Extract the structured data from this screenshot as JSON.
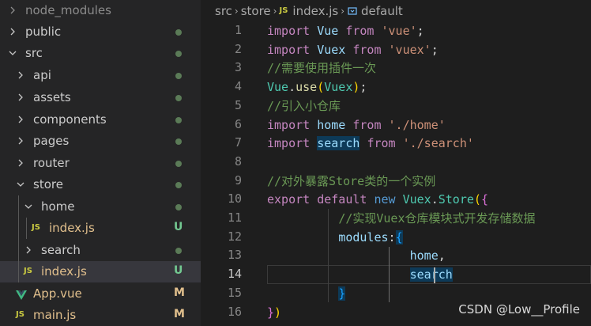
{
  "sidebar": {
    "items": [
      {
        "label": "node_modules"
      },
      {
        "label": "public"
      },
      {
        "label": "src"
      },
      {
        "label": "api"
      },
      {
        "label": "assets"
      },
      {
        "label": "components"
      },
      {
        "label": "pages"
      },
      {
        "label": "router"
      },
      {
        "label": "store"
      },
      {
        "label": "home"
      },
      {
        "label": "index.js",
        "badge": "U",
        "icon": "JS"
      },
      {
        "label": "search"
      },
      {
        "label": "index.js",
        "badge": "U",
        "icon": "JS"
      },
      {
        "label": "App.vue",
        "badge": "M"
      },
      {
        "label": "main.js",
        "badge": "M",
        "icon": "JS"
      }
    ]
  },
  "breadcrumb": {
    "parts": [
      "src",
      "store",
      "index.js",
      "default"
    ],
    "file_icon": "JS"
  },
  "editor": {
    "line_numbers": [
      "1",
      "2",
      "3",
      "4",
      "5",
      "6",
      "7",
      "8",
      "9",
      "10",
      "11",
      "12",
      "13",
      "14",
      "15",
      "16"
    ],
    "active_line": "14",
    "lines": [
      [
        {
          "t": "import",
          "c": "kw"
        },
        {
          "t": " "
        },
        {
          "t": "Vue",
          "c": "var"
        },
        {
          "t": " "
        },
        {
          "t": "from",
          "c": "kw"
        },
        {
          "t": " "
        },
        {
          "t": "'vue'",
          "c": "str"
        },
        {
          "t": ";"
        }
      ],
      [
        {
          "t": "import",
          "c": "kw"
        },
        {
          "t": " "
        },
        {
          "t": "Vuex",
          "c": "var"
        },
        {
          "t": " "
        },
        {
          "t": "from",
          "c": "kw"
        },
        {
          "t": " "
        },
        {
          "t": "'vuex'",
          "c": "str"
        },
        {
          "t": ";"
        }
      ],
      [
        {
          "t": "//需要使用插件一次",
          "c": "cmt"
        }
      ],
      [
        {
          "t": "Vue",
          "c": "cls"
        },
        {
          "t": "."
        },
        {
          "t": "use",
          "c": "fn"
        },
        {
          "t": "(",
          "c": "br1"
        },
        {
          "t": "Vuex",
          "c": "cls"
        },
        {
          "t": ")",
          "c": "br1"
        },
        {
          "t": ";"
        }
      ],
      [
        {
          "t": "//引入小仓库",
          "c": "cmt"
        }
      ],
      [
        {
          "t": "import",
          "c": "kw"
        },
        {
          "t": " "
        },
        {
          "t": "home",
          "c": "var"
        },
        {
          "t": " "
        },
        {
          "t": "from",
          "c": "kw"
        },
        {
          "t": " "
        },
        {
          "t": "'./home'",
          "c": "str"
        }
      ],
      [
        {
          "t": "import",
          "c": "kw"
        },
        {
          "t": " "
        },
        {
          "t": "search",
          "c": "var hl2"
        },
        {
          "t": " "
        },
        {
          "t": "from",
          "c": "kw"
        },
        {
          "t": " "
        },
        {
          "t": "'./search'",
          "c": "str"
        }
      ],
      [],
      [
        {
          "t": "//对外暴露Store类的一个实例",
          "c": "cmt"
        }
      ],
      [
        {
          "t": "export",
          "c": "kw"
        },
        {
          "t": " "
        },
        {
          "t": "default",
          "c": "kw"
        },
        {
          "t": " "
        },
        {
          "t": "new",
          "c": "kw2"
        },
        {
          "t": " "
        },
        {
          "t": "Vuex",
          "c": "cls"
        },
        {
          "t": "."
        },
        {
          "t": "Store",
          "c": "cls"
        },
        {
          "t": "(",
          "c": "br1"
        },
        {
          "t": "{",
          "c": "br2"
        }
      ],
      [
        {
          "t": "          "
        },
        {
          "t": "//实现Vuex仓库模块式开发存储数据",
          "c": "cmt"
        }
      ],
      [
        {
          "t": "          "
        },
        {
          "t": "modules",
          "c": "var"
        },
        {
          "t": ":"
        },
        {
          "t": "{",
          "c": "br3 hl2"
        }
      ],
      [
        {
          "t": "                    "
        },
        {
          "t": "home",
          "c": "var"
        },
        {
          "t": ","
        }
      ],
      [
        {
          "t": "                    "
        },
        {
          "t": "search",
          "c": "var hl2"
        }
      ],
      [
        {
          "t": "          "
        },
        {
          "t": "}",
          "c": "br3 hl2"
        }
      ],
      [
        {
          "t": "}",
          "c": "br2"
        },
        {
          "t": ")",
          "c": "br1"
        }
      ]
    ]
  },
  "watermark": "CSDN @Low__Profile",
  "colors": {
    "sidebar_bg": "#252526",
    "editor_bg": "#1e1e1e",
    "selected_bg": "#37373d",
    "untracked": "#73c991",
    "modified": "#e2c08d",
    "js_icon": "#cbcb41",
    "vue_icon": "#41b883"
  }
}
